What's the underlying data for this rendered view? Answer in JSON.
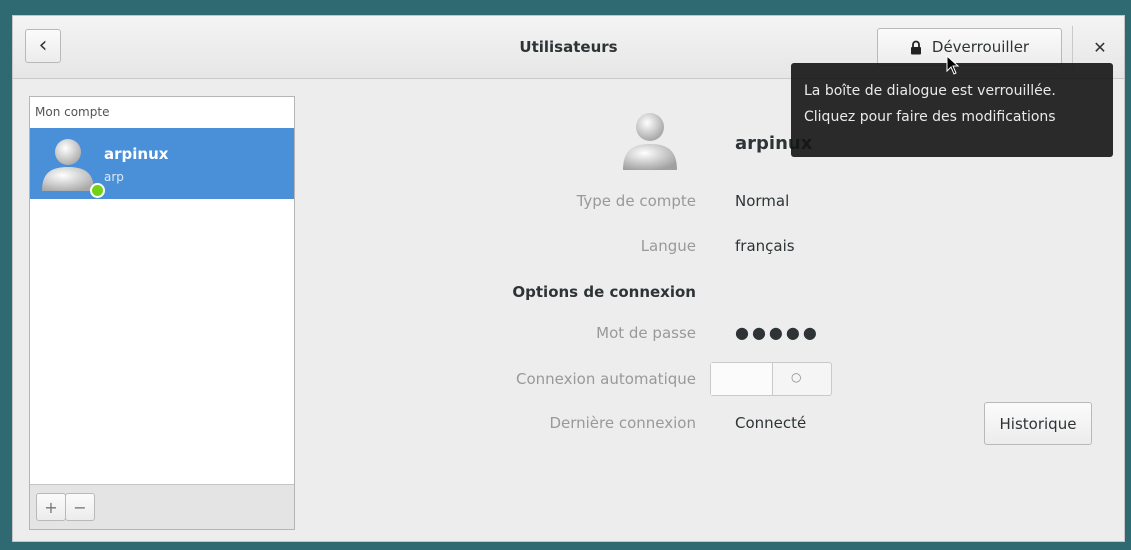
{
  "header": {
    "title": "Utilisateurs",
    "back_icon": "‹",
    "unlock_label": "Déverrouiller",
    "close_icon": "✕"
  },
  "tooltip": {
    "line1": "La boîte de dialogue est verrouillée.",
    "line2": "Cliquez pour faire des modifications"
  },
  "sidebar": {
    "header": "Mon compte",
    "users": [
      {
        "name": "arpinux",
        "login": "arp",
        "online": true
      }
    ],
    "add_label": "+",
    "remove_label": "−"
  },
  "details": {
    "display_name": "arpinux",
    "account_type_label": "Type de compte",
    "account_type_value": "Normal",
    "language_label": "Langue",
    "language_value": "français",
    "login_options_heading": "Options de connexion",
    "password_label": "Mot de passe",
    "password_value": "●●●●●",
    "auto_login_label": "Connexion automatique",
    "auto_login_state": "○",
    "last_login_label": "Dernière connexion",
    "last_login_value": "Connecté",
    "history_label": "Historique"
  },
  "colors": {
    "accent": "#4a90d9",
    "online": "#73d216"
  }
}
